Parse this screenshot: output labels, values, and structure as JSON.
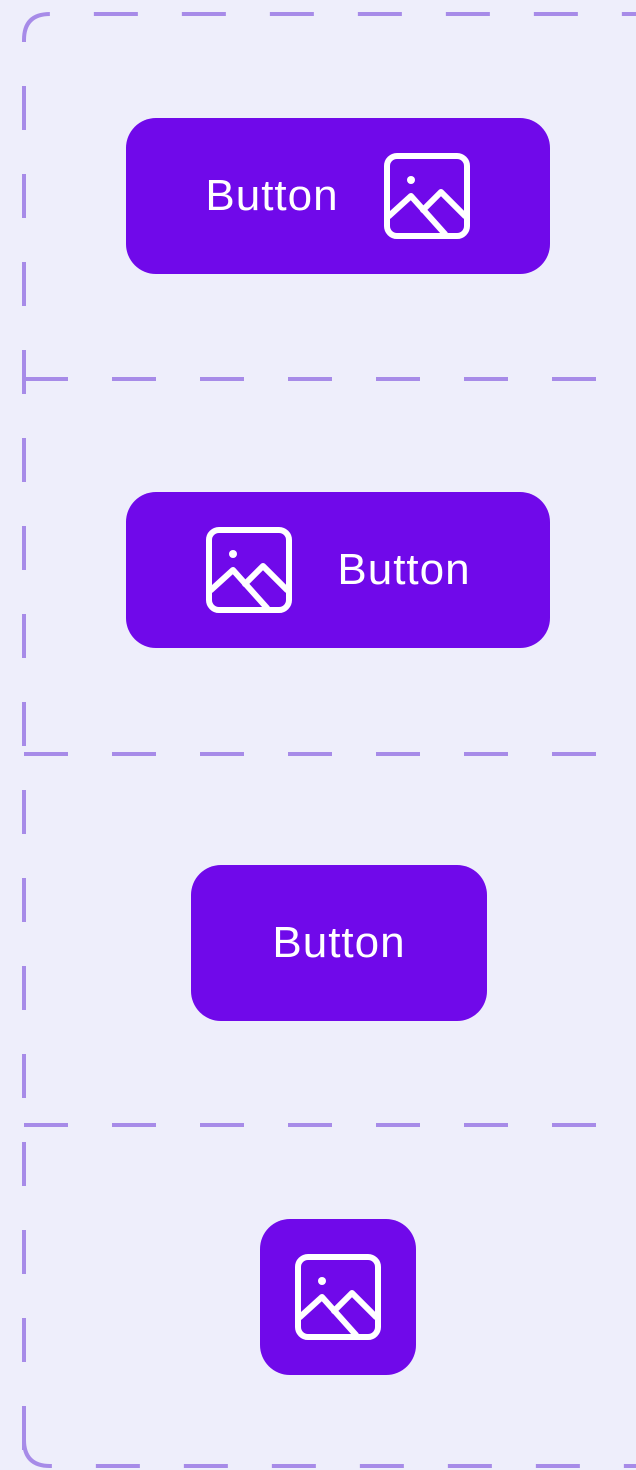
{
  "colors": {
    "background": "#EEEEFB",
    "button": "#7009EA",
    "button_text": "#FFFFFF",
    "guide": "#A78BE8"
  },
  "variants": [
    {
      "label": "Button",
      "icon": "image-icon",
      "icon_position": "trailing"
    },
    {
      "label": "Button",
      "icon": "image-icon",
      "icon_position": "leading"
    },
    {
      "label": "Button",
      "icon": null,
      "icon_position": "none"
    },
    {
      "label": "",
      "icon": "image-icon",
      "icon_position": "only"
    }
  ]
}
